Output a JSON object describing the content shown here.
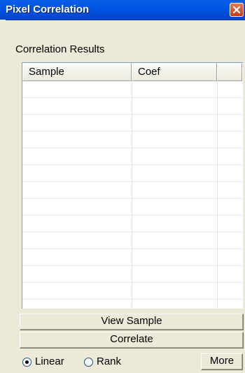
{
  "window": {
    "title": "Pixel Correlation"
  },
  "group": {
    "label": "Correlation Results"
  },
  "table": {
    "columns": [
      "Sample",
      "Coef",
      ""
    ],
    "rows": []
  },
  "buttons": {
    "view_sample": "View Sample",
    "correlate": "Correlate",
    "more": "More"
  },
  "method": {
    "options": [
      "Linear",
      "Rank"
    ],
    "selected": "Linear"
  },
  "colors": {
    "titlebar": "#0054e3",
    "close_button": "#c63a12",
    "window_bg": "#ece9d8"
  }
}
